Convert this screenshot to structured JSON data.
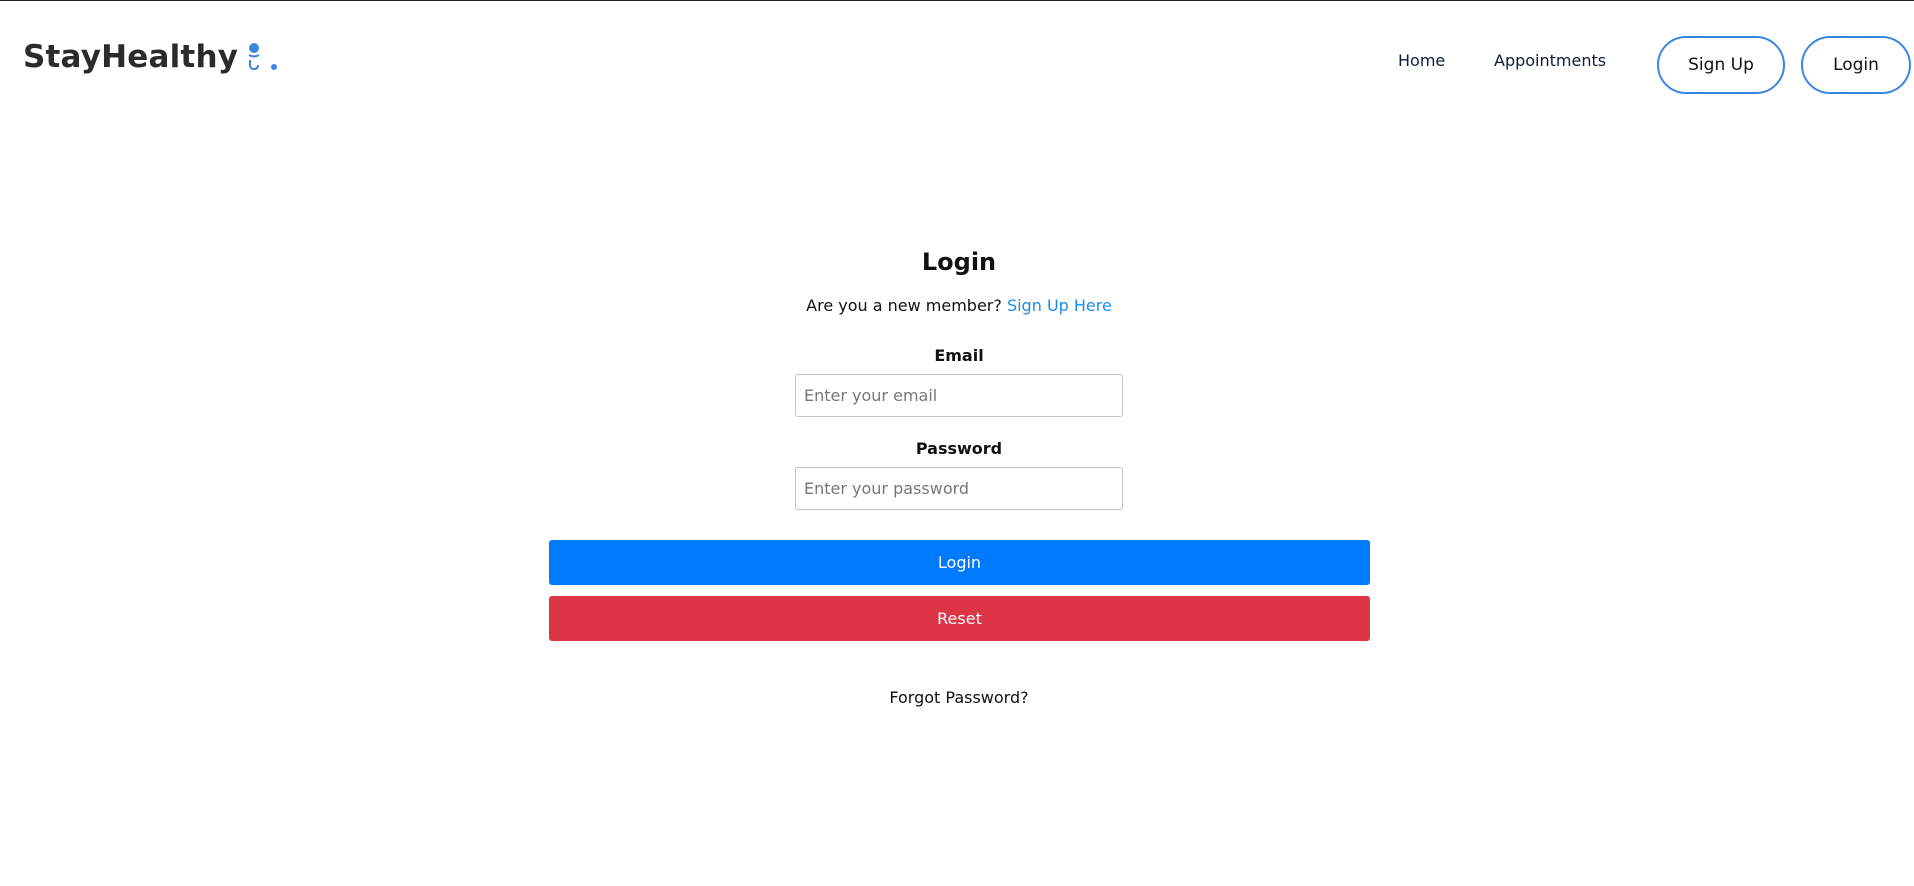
{
  "header": {
    "brand": "StayHealthy",
    "nav": {
      "home": "Home",
      "appointments": "Appointments"
    },
    "buttons": {
      "signup": "Sign Up",
      "login": "Login"
    }
  },
  "form": {
    "title": "Login",
    "member_prompt": "Are you a new member?",
    "signup_link": "Sign Up Here",
    "email_label": "Email",
    "email_placeholder": "Enter your email",
    "password_label": "Password",
    "password_placeholder": "Enter your password",
    "submit_label": "Login",
    "reset_label": "Reset",
    "forgot_label": "Forgot Password?"
  },
  "colors": {
    "accent_blue": "#007bff",
    "danger_red": "#dc3545",
    "link_blue": "#1a8cf0",
    "outline_blue": "#3a86e0"
  },
  "icons": {
    "brand_icon": "doctor-stethoscope-icon"
  }
}
